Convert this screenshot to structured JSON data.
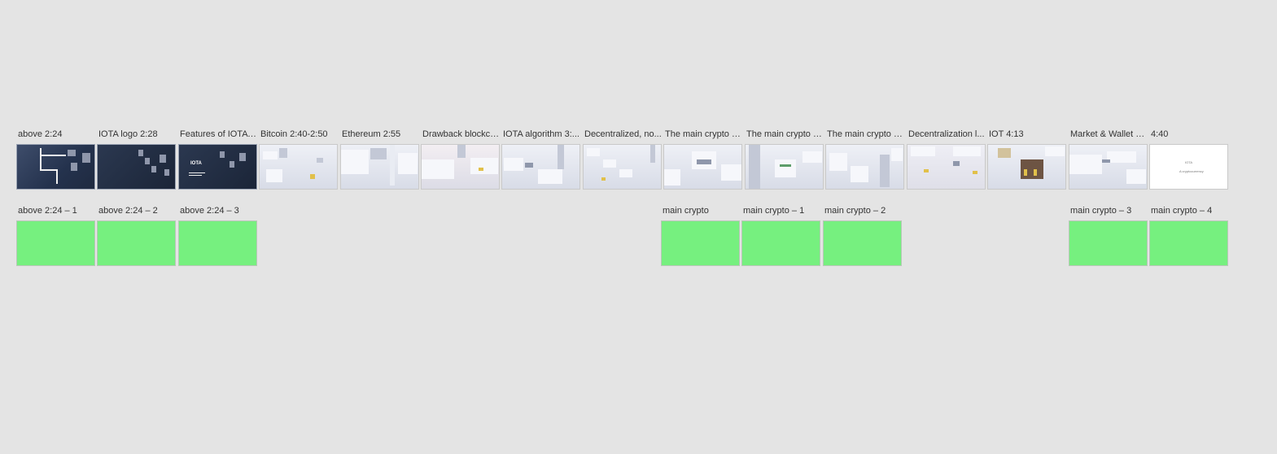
{
  "timeline": {
    "frames": [
      {
        "label": "above 2:24",
        "style": "dark"
      },
      {
        "label": "IOTA logo 2:28",
        "style": "darker"
      },
      {
        "label": "Features of IOTA 2...",
        "style": "darker"
      },
      {
        "label": "Bitcoin 2:40-2:50",
        "style": "city"
      },
      {
        "label": "Ethereum 2:55",
        "style": "city"
      },
      {
        "label": "Drawback blockch...",
        "style": "city"
      },
      {
        "label": "IOTA algorithm 3:...",
        "style": "city"
      },
      {
        "label": "Decentralized, no...",
        "style": "city"
      },
      {
        "label": "The main crypto c...",
        "style": "city"
      },
      {
        "label": "The main crypto c...",
        "style": "city"
      },
      {
        "label": "The main crypto c...",
        "style": "city"
      },
      {
        "label": "Decentralization l...",
        "style": "city"
      },
      {
        "label": "IOT 4:13",
        "style": "city"
      },
      {
        "label": "Market & Wallet 4...",
        "style": "city"
      },
      {
        "label": "4:40",
        "style": "white"
      }
    ],
    "logo_text": "IOTA",
    "end_card_title": "IOTA",
    "end_card_subtitle": "A cryptocurrency",
    "overlays": [
      {
        "label": "above 2:24 – 1"
      },
      {
        "label": "above 2:24 – 2"
      },
      {
        "label": "above 2:24 – 3"
      },
      {
        "label": "main crypto"
      },
      {
        "label": "main crypto – 1"
      },
      {
        "label": "main crypto – 2"
      },
      {
        "label": "main crypto – 3"
      },
      {
        "label": "main crypto – 4"
      }
    ],
    "overlay_color": "#76f07f",
    "background_color": "#e4e4e4"
  }
}
